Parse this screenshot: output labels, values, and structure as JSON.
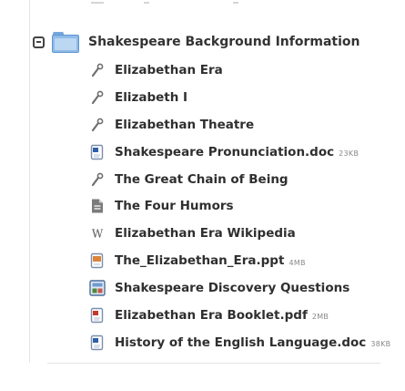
{
  "folder": {
    "name": "Shakespeare Background Information",
    "expanded": true,
    "toggle_icon": "collapse-minus-icon",
    "folder_icon": "folder-icon",
    "folder_color": "#8fbbe8"
  },
  "items": [
    {
      "label": "Elizabethan Era",
      "icon": "link-icon",
      "size": ""
    },
    {
      "label": "Elizabeth I",
      "icon": "link-icon",
      "size": ""
    },
    {
      "label": "Elizabethan Theatre",
      "icon": "link-icon",
      "size": ""
    },
    {
      "label": "Shakespeare Pronunciation.doc",
      "icon": "word-document-icon",
      "size": "23KB"
    },
    {
      "label": "The Great Chain of Being",
      "icon": "link-icon",
      "size": ""
    },
    {
      "label": "The Four Humors",
      "icon": "page-icon",
      "size": ""
    },
    {
      "label": "Elizabethan Era Wikipedia",
      "icon": "wikipedia-icon",
      "size": ""
    },
    {
      "label": "The_Elizabethan_Era.ppt",
      "icon": "powerpoint-icon",
      "size": "4MB"
    },
    {
      "label": "Shakespeare Discovery Questions",
      "icon": "discussion-icon",
      "size": ""
    },
    {
      "label": "Elizabethan Era Booklet.pdf",
      "icon": "pdf-icon",
      "size": "2MB"
    },
    {
      "label": "History of the English Language.doc",
      "icon": "word-document-icon",
      "size": "38KB"
    }
  ]
}
